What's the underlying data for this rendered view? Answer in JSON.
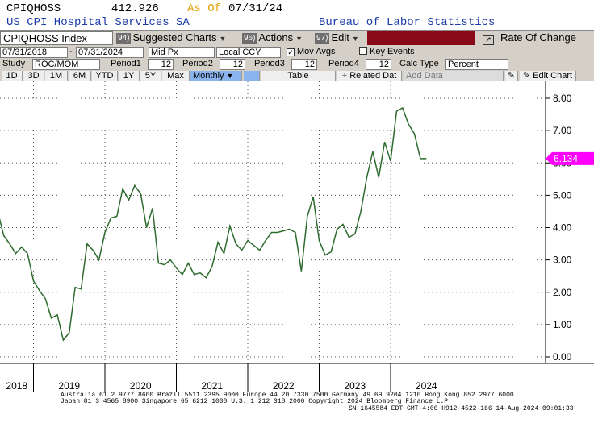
{
  "header": {
    "ticker": "CPIQHOSS",
    "price": "412.926",
    "asof_label": "As Of",
    "asof_date": "07/31/24",
    "description": "US CPI Hospital Services SA",
    "source": "Bureau of Labor Statistics"
  },
  "toolbar": {
    "security_field": "CPIQHOSS Index",
    "suggested_num": "94)",
    "suggested_label": "Suggested Charts",
    "actions_num": "96)",
    "actions_label": "Actions",
    "edit_num": "97)",
    "edit_label": "Edit",
    "rate_of_change_label": "Rate Of Change"
  },
  "row2": {
    "start_date": "07/31/2018",
    "end_date": "07/31/2024",
    "pricing": "Mid Px",
    "currency": "Local CCY",
    "mov_avgs_label": "Mov Avgs",
    "key_events_label": "Key Events"
  },
  "row3": {
    "study_label": "Study",
    "study_value": "ROC/MOM",
    "period1_label": "Period1",
    "period1_value": "12",
    "period2_label": "Period2",
    "period2_value": "12",
    "period3_label": "Period3",
    "period3_value": "12",
    "period4_label": "Period4",
    "period4_value": "12",
    "calc_type_label": "Calc Type",
    "calc_type_value": "Percent"
  },
  "row4": {
    "periods": [
      "1D",
      "3D",
      "1M",
      "6M",
      "YTD",
      "1Y",
      "5Y",
      "Max"
    ],
    "frequency": "Monthly",
    "table_label": "Table",
    "related_label": "Related Dat",
    "add_data_placeholder": "Add Data",
    "edit_chart_label": "Edit Chart"
  },
  "footer": {
    "line1": "Australia 61 2 9777 8600 Brazil 5511 2395 9000 Europe 44 20 7330 7500 Germany 49 69 9204 1210 Hong Kong 852 2977 6000",
    "line2": "Japan 81 3 4565 8900       Singapore 65 6212 1000       U.S. 1 212 318 2000             Copyright 2024 Bloomberg Finance L.P.",
    "line3": "SN 1645584 EDT  GMT-4:00 H912-4522-166 14-Aug-2024 09:01:33"
  },
  "colors": {
    "line": "#2e6b2e",
    "last_value_badge": "#ff00ff",
    "edit_bar": "#8b0a1a",
    "asof": "#e0a000",
    "header_blue": "#1a3aa8"
  },
  "chart_data": {
    "type": "line",
    "x_tick_labels": [
      "2018",
      "2019",
      "2020",
      "2021",
      "2022",
      "2023",
      "2024"
    ],
    "y_tick_labels": [
      "0.00",
      "1.00",
      "2.00",
      "3.00",
      "4.00",
      "5.00",
      "6.00",
      "7.00",
      "8.00"
    ],
    "ylim": [
      0,
      8.5
    ],
    "last_value_label": "6.134",
    "grid": true,
    "series": [
      {
        "x": [
          "2018-07",
          "2018-08",
          "2018-09",
          "2018-10",
          "2018-11",
          "2018-12",
          "2019-01",
          "2019-02",
          "2019-03",
          "2019-04",
          "2019-05",
          "2019-06",
          "2019-07",
          "2019-08",
          "2019-09",
          "2019-10",
          "2019-11",
          "2019-12",
          "2020-01",
          "2020-02",
          "2020-03",
          "2020-04",
          "2020-05",
          "2020-06",
          "2020-07",
          "2020-08",
          "2020-09",
          "2020-10",
          "2020-11",
          "2020-12",
          "2021-01",
          "2021-02",
          "2021-03",
          "2021-04",
          "2021-05",
          "2021-06",
          "2021-07",
          "2021-08",
          "2021-09",
          "2021-10",
          "2021-11",
          "2021-12",
          "2022-01",
          "2022-02",
          "2022-03",
          "2022-04",
          "2022-05",
          "2022-06",
          "2022-07",
          "2022-08",
          "2022-09",
          "2022-10",
          "2022-11",
          "2022-12",
          "2023-01",
          "2023-02",
          "2023-03",
          "2023-04",
          "2023-05",
          "2023-06",
          "2023-07",
          "2023-08",
          "2023-09",
          "2023-10",
          "2023-11",
          "2023-12",
          "2024-01",
          "2024-02",
          "2024-03",
          "2024-04",
          "2024-05",
          "2024-06",
          "2024-07"
        ],
        "values": [
          4.5,
          3.75,
          3.5,
          3.2,
          3.4,
          3.2,
          2.35,
          2.05,
          1.8,
          1.2,
          1.3,
          0.52,
          0.75,
          2.15,
          2.1,
          3.5,
          3.3,
          3.0,
          3.85,
          4.3,
          4.35,
          5.2,
          4.85,
          5.3,
          5.05,
          4.0,
          4.6,
          2.9,
          2.85,
          3.0,
          2.75,
          2.55,
          2.9,
          2.55,
          2.6,
          2.45,
          2.8,
          3.55,
          3.2,
          4.05,
          3.5,
          3.3,
          3.6,
          3.45,
          3.3,
          3.6,
          3.85,
          3.85,
          3.9,
          3.95,
          3.85,
          2.65,
          4.35,
          4.95,
          3.6,
          3.15,
          3.25,
          3.95,
          4.1,
          3.7,
          3.8,
          4.5,
          5.55,
          6.35,
          5.55,
          6.65,
          6.05,
          7.6,
          7.7,
          7.2,
          6.9,
          6.134,
          6.134
        ]
      }
    ]
  }
}
